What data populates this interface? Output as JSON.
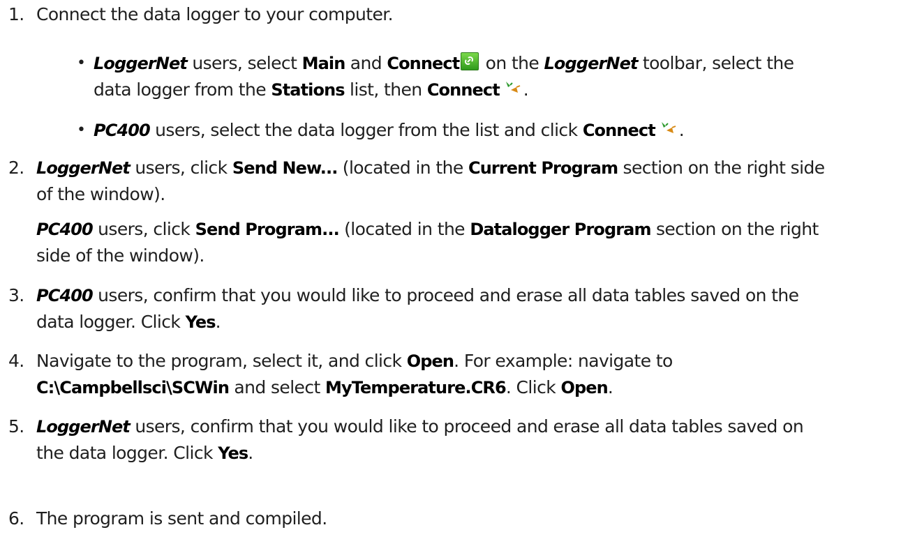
{
  "steps": [
    {
      "n": "1.",
      "text": "Connect the data logger to your computer."
    },
    {
      "n": "2.",
      "p1_user": "LoggerNet",
      "p1_a": " users, click ",
      "p1_b": "Send New...",
      "p1_c": " (located in the ",
      "p1_d": "Current Program",
      "p1_e": " section on the right side",
      "p1_f": "of the window).",
      "p2_user": "PC400",
      "p2_a": " users, click ",
      "p2_b": "Send Program...",
      "p2_c": " (located in the ",
      "p2_d": "Datalogger Program",
      "p2_e": " section on the right",
      "p2_f": "side of the window)."
    },
    {
      "n": "3.",
      "user": "PC400",
      "a": " users, confirm that you would like to proceed and erase all data tables saved on the",
      "b": "data logger. Click ",
      "yes": "Yes",
      "end": "."
    },
    {
      "n": "4.",
      "a": "Navigate to the program, select it, and click ",
      "open": "Open",
      "b": ". For example: navigate to",
      "path": "C:\\Campbellsci\\SCWin",
      "c": " and select ",
      "file": "MyTemperature.CR6",
      "d": ". Click ",
      "open2": "Open",
      "end": "."
    },
    {
      "n": "5.",
      "user": "LoggerNet",
      "a": " users, confirm that you would like to proceed and erase all data tables saved on",
      "b": "the data logger. Click ",
      "yes": "Yes",
      "end": "."
    },
    {
      "n": "6.",
      "text": "The program is sent and compiled."
    }
  ],
  "bullets": [
    {
      "user": "LoggerNet",
      "a": " users, select ",
      "main": "Main",
      "b": " and ",
      "connect": "Connect",
      "c": " on the ",
      "user2": "LoggerNet",
      "d": " toolbar, select the",
      "e": "data logger from the ",
      "stations": "Stations",
      "f": " list, then ",
      "connect2": "Connect",
      "end": "."
    },
    {
      "user": "PC400",
      "a": " users, select the data logger from the list and click ",
      "connect": "Connect",
      "end": "."
    }
  ],
  "bullet_glyph": "•",
  "icons": {
    "connect_toolbar": "link-icon",
    "connect_plug": "plug-icon"
  }
}
